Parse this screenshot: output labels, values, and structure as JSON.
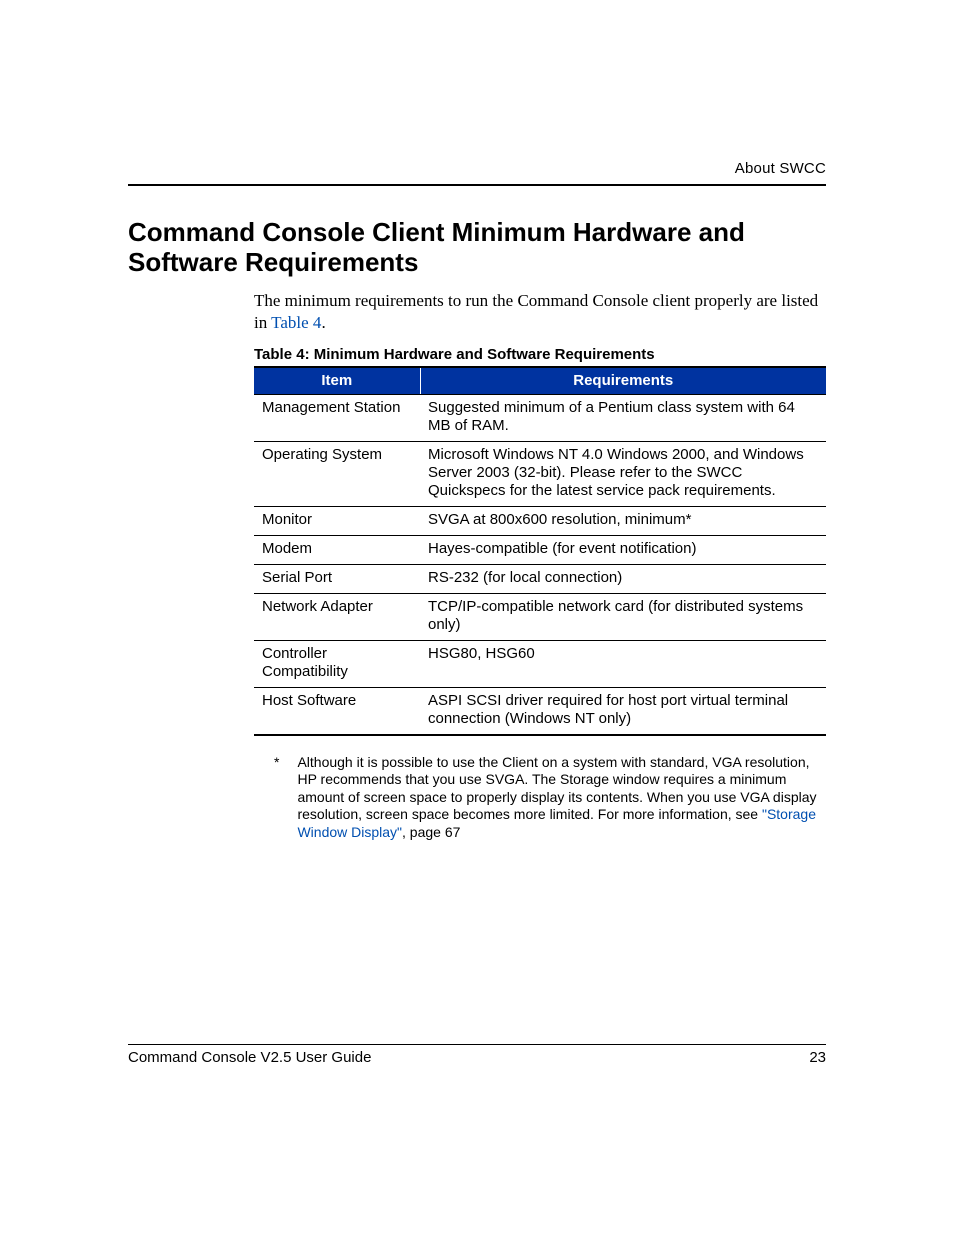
{
  "header": {
    "section_label": "About SWCC"
  },
  "title": "Command Console Client Minimum Hardware and Software Requirements",
  "intro": {
    "pre": "The minimum requirements to run the Command Console client properly are listed in ",
    "link": "Table 4",
    "post": "."
  },
  "table": {
    "caption": "Table 4:  Minimum Hardware and Software Requirements",
    "columns": {
      "item": "Item",
      "req": "Requirements"
    }
  },
  "chart_data": {
    "type": "table",
    "title": "Minimum Hardware and Software Requirements",
    "columns": [
      "Item",
      "Requirements"
    ],
    "rows": [
      {
        "item": "Management Station",
        "req": "Suggested minimum of a Pentium class system with 64 MB of RAM."
      },
      {
        "item": "Operating System",
        "req": "Microsoft Windows NT 4.0 Windows 2000, and Windows Server 2003 (32-bit). Please refer to the SWCC Quickspecs for the latest service pack requirements."
      },
      {
        "item": "Monitor",
        "req": "SVGA at 800x600 resolution, minimum*"
      },
      {
        "item": "Modem",
        "req": "Hayes-compatible (for event notification)"
      },
      {
        "item": "Serial Port",
        "req": "RS-232 (for local connection)"
      },
      {
        "item": "Network Adapter",
        "req": "TCP/IP-compatible network card (for distributed systems only)"
      },
      {
        "item": "Controller Compatibility",
        "req": "HSG80, HSG60"
      },
      {
        "item": "Host Software",
        "req": "ASPI SCSI driver required for host port virtual terminal connection (Windows NT only)"
      }
    ]
  },
  "footnote": {
    "mark": "*",
    "pre": "Although it is possible to use the Client on a system with standard, VGA resolution, HP recommends that you use SVGA. The Storage window requires a minimum amount of screen space to properly display its contents. When you use VGA display resolution, screen space becomes more limited. For more information, see ",
    "link": "\"Storage Window Display\"",
    "post": ", page 67"
  },
  "footer": {
    "doc_title": "Command Console V2.5 User Guide",
    "page_number": "23"
  }
}
